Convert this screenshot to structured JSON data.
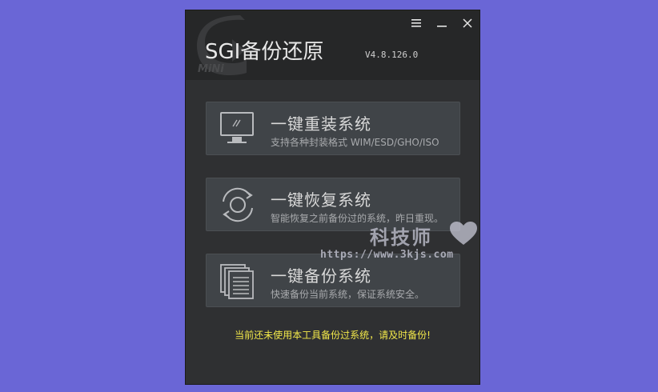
{
  "app": {
    "title": "SGI备份还原",
    "mini_label": "MiNi",
    "version": "V4.8.126.0"
  },
  "window_controls": {
    "menu_icon": "menu-icon",
    "minimize_icon": "minimize-icon",
    "close_icon": "close-icon"
  },
  "actions": [
    {
      "title": "一键重装系统",
      "subtitle": "支持各种封装格式 WIM/ESD/GHO/ISO",
      "icon": "monitor-icon"
    },
    {
      "title": "一键恢复系统",
      "subtitle": "智能恢复之前备份过的系统，昨日重现。",
      "icon": "restore-cycle-icon"
    },
    {
      "title": "一键备份系统",
      "subtitle": "快速备份当前系统，保证系统安全。",
      "icon": "documents-stack-icon"
    }
  ],
  "warning": "当前还未使用本工具备份过系统，请及时备份!",
  "watermark": {
    "text": "科技师",
    "url": "https://www.3kjs.com"
  },
  "colors": {
    "background": "#6a66d6",
    "window": "#2f3032",
    "titlebar": "#262728",
    "card": "#404448",
    "warning_text": "#f2e84a"
  }
}
